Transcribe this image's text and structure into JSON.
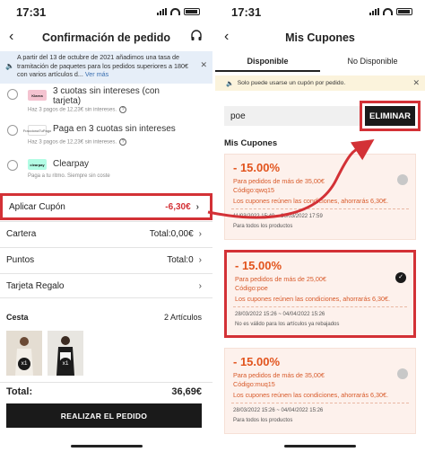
{
  "left": {
    "time": "17:31",
    "title": "Confirmación de pedido",
    "notice": "A partir del 13 de octubre de 2021 añadimos una tasa de tramitación de paquetes para los pedidos superiores a 180€ con varios artículos d...",
    "notice_link": "Ver más",
    "payments": [
      {
        "logo": "Klarna",
        "title": "3 cuotas sin intereses (con tarjeta)",
        "sub": "Haz 3 pagos de 12,23€ sin intereses."
      },
      {
        "logo": "FraccionaTuPago",
        "title": "Paga en 3 cuotas sin intereses",
        "sub": "Haz 3 pagos de 12,23€ sin intereses."
      },
      {
        "logo": "clearpay",
        "title": "Clearpay",
        "sub": "Paga a tu ritmo. Siempre sin coste"
      }
    ],
    "rows": {
      "coupon_label": "Aplicar Cupón",
      "coupon_value": "-6,30€",
      "wallet_label": "Cartera",
      "wallet_value": "Total:0,00€",
      "points_label": "Puntos",
      "points_value": "Total:0",
      "gift_label": "Tarjeta Regalo"
    },
    "cesta": {
      "label": "Cesta",
      "count": "2 Artículos",
      "qty1": "x1",
      "qty2": "x1"
    },
    "total_label": "Total:",
    "total_value": "36,69€",
    "cta": "REALIZAR EL PEDIDO"
  },
  "right": {
    "time": "17:31",
    "title": "Mis Cupones",
    "tabs": [
      "Disponible",
      "No Disponible"
    ],
    "notice": "Solo puede usarse un cupón por pedido.",
    "code_value": "poe",
    "remove_label": "ELIMINAR",
    "section_title": "Mis Cupones",
    "coupons": [
      {
        "pct": "- 15.00%",
        "line1": "Para pedidos de más de 35,00€",
        "line2": "Código:qwq15",
        "line3": "Los cupones reúnen las condiciones, ahorrarás 6,30€.",
        "dates": "11/03/2022 15:40 ~ 30/03/2022 17:59",
        "note": "Para todos los productos"
      },
      {
        "pct": "- 15.00%",
        "line1": "Para pedidos de más de 25,00€",
        "line2": "Código:poe",
        "line3": "Los cupones reúnen las condiciones, ahorrarás 6,30€.",
        "dates": "28/03/2022 15:26 ~ 04/04/2022 15:26",
        "note": "No es válido para los artículos ya rebajados"
      },
      {
        "pct": "- 15.00%",
        "line1": "Para pedidos de más de 35,00€",
        "line2": "Código:muq15",
        "line3": "Los cupones reúnen las condiciones, ahorrarás 6,30€.",
        "dates": "28/03/2022 15:26 ~ 04/04/2022 15:26",
        "note": "Para todos los productos"
      }
    ]
  },
  "colors": {
    "accent_red": "#d33136",
    "coupon_orange": "#e2541d",
    "notice_blue": "#e6eef8",
    "notice_yellow": "#fbf3dc"
  },
  "icons": [
    "back-icon",
    "headset-icon",
    "speaker-icon",
    "close-icon",
    "question-icon",
    "chevron-right-icon",
    "check-icon"
  ]
}
